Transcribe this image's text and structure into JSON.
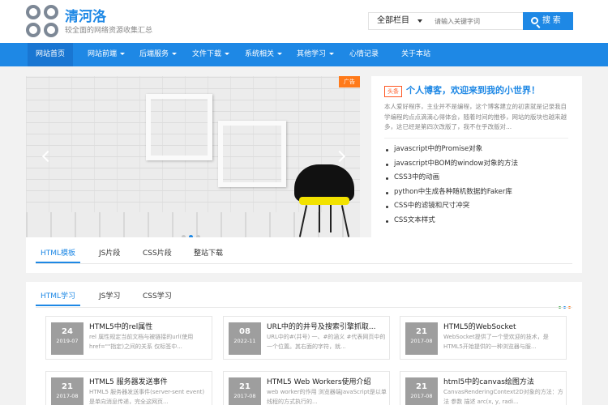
{
  "site": {
    "title": "清河洛",
    "subtitle": "较全面的网络资源收集汇总"
  },
  "search": {
    "category": "全部栏目",
    "placeholder": "请输入关键字词",
    "button": "搜 索"
  },
  "nav": [
    {
      "label": "网站首页",
      "dropdown": false
    },
    {
      "label": "网站前端",
      "dropdown": true
    },
    {
      "label": "后端服务",
      "dropdown": true
    },
    {
      "label": "文件下载",
      "dropdown": true
    },
    {
      "label": "系统相关",
      "dropdown": true
    },
    {
      "label": "其他学习",
      "dropdown": true
    },
    {
      "label": "心情记录",
      "dropdown": false
    },
    {
      "label": "关于本站",
      "dropdown": false
    }
  ],
  "slider": {
    "ad_label": "广告",
    "active_dot": 2,
    "dot_count": 3
  },
  "headline": {
    "tag": "头条",
    "title": "个人博客，欢迎来到我的小世界！",
    "desc": "本人爱好程序，主业并不是编程，这个博客建立的初衷就是记录我自学编程的点点滴滴心得体会，随着时间的推移，网站的版块也越来越多，这已经是第四次改版了，我不在乎改版对...",
    "items": [
      "javascript中的Promise对象",
      "javascript中BOM的window对象的方法",
      "CSS3中的动画",
      "python中生成各种随机数据的Faker库",
      "CSS中的滤镜和尺寸冲突",
      "CSS文本样式"
    ]
  },
  "tabs1": [
    "HTML模板",
    "JS片段",
    "CSS片段",
    "整站下载"
  ],
  "tabs2": [
    "HTML学习",
    "JS学习",
    "CSS学习"
  ],
  "colors": {
    "accent": "#1e88e5",
    "ad": "#ff7a1a",
    "dot_colors": [
      "#ff7a1a",
      "#4caf50",
      "#1e88e5"
    ]
  },
  "articles": [
    {
      "day": "24",
      "ym": "2019-07",
      "title": "HTML5中的rel属性",
      "desc": "rel 属性规定当前文档与被链接的url(使用href=\"\"指定)之间的关系 仅标签中..."
    },
    {
      "day": "08",
      "ym": "2022-11",
      "title": "URL中的的井号及搜索引擎抓取...",
      "desc": "URL中的#(井号) 一、#的涵义 #代表网页中的一个位置。其右面的字符，就..."
    },
    {
      "day": "21",
      "ym": "2017-08",
      "title": "HTML5的WebSocket",
      "desc": "WebSocket提供了一个受欢迎的技术，是HTML5开始提供的一种浏览器与服..."
    },
    {
      "day": "21",
      "ym": "2017-08",
      "title": "HTML5 服务器发送事件",
      "desc": "HTML5 服务器发送事件(server-sent event)是单向消息传递，完全这网页..."
    },
    {
      "day": "21",
      "ym": "2017-08",
      "title": "HTML5 Web Workers使用介绍",
      "desc": "web worker的作用 浏览器端JavaScript是以单线程的方式执行的..."
    },
    {
      "day": "21",
      "ym": "2017-08",
      "title": "html5中的canvas绘图方法",
      "desc": "CanvasRenderingContext2D对象的方法：方法 参数 描述 arc(x, y, radi..."
    }
  ]
}
